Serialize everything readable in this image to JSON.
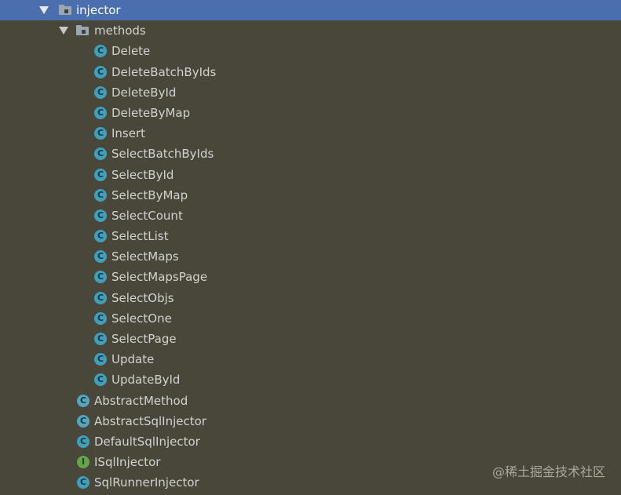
{
  "tree": {
    "root_label": "injector",
    "methods_label": "methods",
    "method_classes": [
      "Delete",
      "DeleteBatchByIds",
      "DeleteById",
      "DeleteByMap",
      "Insert",
      "SelectBatchByIds",
      "SelectById",
      "SelectByMap",
      "SelectCount",
      "SelectList",
      "SelectMaps",
      "SelectMapsPage",
      "SelectObjs",
      "SelectOne",
      "SelectPage",
      "Update",
      "UpdateById"
    ],
    "injector_classes": [
      {
        "label": "AbstractMethod",
        "kind": "abstract",
        "icon_letter": "C"
      },
      {
        "label": "AbstractSqlInjector",
        "kind": "abstract",
        "icon_letter": "C"
      },
      {
        "label": "DefaultSqlInjector",
        "kind": "class",
        "icon_letter": "C"
      },
      {
        "label": "ISqlInjector",
        "kind": "interface",
        "icon_letter": "I"
      },
      {
        "label": "SqlRunnerInjector",
        "kind": "class",
        "icon_letter": "C"
      }
    ],
    "class_icon_letter": "C"
  },
  "watermark": "@稀土掘金技术社区",
  "colors": {
    "background": "#484739",
    "selected_row": "#4b6eaf",
    "class_icon": "#40a0bb",
    "interface_icon": "#62a54a",
    "folder_icon": "#9aa7b0"
  }
}
